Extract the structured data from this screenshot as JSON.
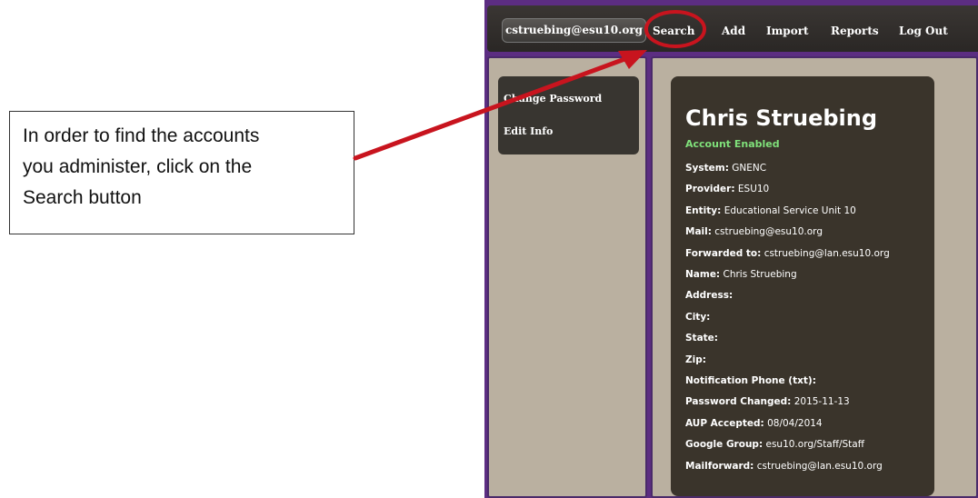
{
  "callout": {
    "lines": [
      "In order to find the accounts",
      "you administer, click on the",
      "Search button"
    ]
  },
  "topbar": {
    "user": "cstruebing@esu10.org",
    "nav": [
      {
        "label": "Search"
      },
      {
        "label": "Add"
      },
      {
        "label": "Import"
      },
      {
        "label": "Reports"
      },
      {
        "label": "Log Out"
      }
    ]
  },
  "sidebar": {
    "items": [
      {
        "label": "Change Password"
      },
      {
        "label": "Edit Info"
      }
    ]
  },
  "profile": {
    "name": "Chris Struebing",
    "status": "Account Enabled",
    "fields": [
      {
        "key": "System:",
        "value": "GNENC"
      },
      {
        "key": "Provider:",
        "value": "ESU10"
      },
      {
        "key": "Entity:",
        "value": "Educational Service Unit 10"
      },
      {
        "key": "Mail:",
        "value": "cstruebing@esu10.org"
      },
      {
        "key": "Forwarded to:",
        "value": "cstruebing@lan.esu10.org"
      },
      {
        "key": "Name:",
        "value": "Chris Struebing"
      },
      {
        "key": "Address:",
        "value": ""
      },
      {
        "key": "City:",
        "value": ""
      },
      {
        "key": "State:",
        "value": ""
      },
      {
        "key": "Zip:",
        "value": ""
      },
      {
        "key": "Notification Phone (txt):",
        "value": ""
      },
      {
        "key": "Password Changed:",
        "value": "2015-11-13"
      },
      {
        "key": "AUP Accepted:",
        "value": "08/04/2014"
      },
      {
        "key": "Google Group:",
        "value": "esu10.org/Staff/Staff"
      },
      {
        "key": "Mailforward:",
        "value": "cstruebing@lan.esu10.org"
      }
    ]
  },
  "colors": {
    "annotation_red": "#c8141e",
    "status_green": "#7fe07a",
    "frame_purple": "#5c2d82",
    "panel_tan": "#bab0a0",
    "card_dark": "#3a342b"
  }
}
